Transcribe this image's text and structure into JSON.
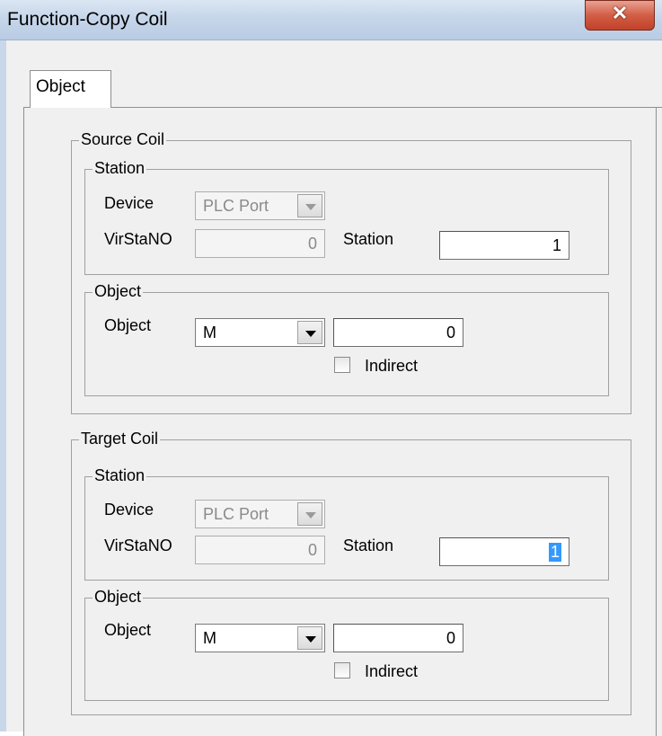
{
  "window": {
    "title": "Function-Copy Coil",
    "close_glyph": "✕"
  },
  "tabs": [
    {
      "label": "Object"
    }
  ],
  "source": {
    "group_label": "Source Coil",
    "station": {
      "group_label": "Station",
      "device_label": "Device",
      "device_value": "PLC Port",
      "virstano_label": "VirStaNO",
      "virstano_value": "0",
      "station_label": "Station",
      "station_value": "1"
    },
    "object": {
      "group_label": "Object",
      "object_label": "Object",
      "object_type": "M",
      "object_value": "0",
      "indirect_label": "Indirect",
      "indirect_checked": false
    }
  },
  "target": {
    "group_label": "Target Coil",
    "station": {
      "group_label": "Station",
      "device_label": "Device",
      "device_value": "PLC Port",
      "virstano_label": "VirStaNO",
      "virstano_value": "0",
      "station_label": "Station",
      "station_value": "1"
    },
    "object": {
      "group_label": "Object",
      "object_label": "Object",
      "object_type": "M",
      "object_value": "0",
      "indirect_label": "Indirect",
      "indirect_checked": false
    }
  }
}
